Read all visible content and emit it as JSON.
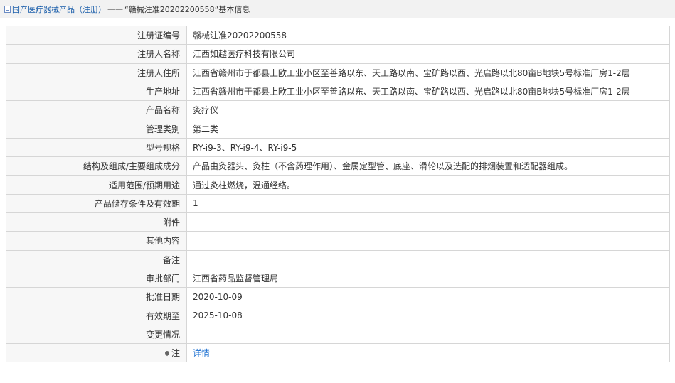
{
  "breadcrumb": {
    "root": "国产医疗器械产品（注册）",
    "separator": "——",
    "current": "“赣械注准20202200558”基本信息"
  },
  "rows": [
    {
      "label": "注册证编号",
      "value": "赣械注准20202200558"
    },
    {
      "label": "注册人名称",
      "value": "江西如越医疗科技有限公司"
    },
    {
      "label": "注册人住所",
      "value": "江西省赣州市于都县上欧工业小区至善路以东、天工路以南、宝矿路以西、光启路以北80亩B地块5号标准厂房1-2层"
    },
    {
      "label": "生产地址",
      "value": "江西省赣州市于都县上欧工业小区至善路以东、天工路以南、宝矿路以西、光启路以北80亩B地块5号标准厂房1-2层"
    },
    {
      "label": "产品名称",
      "value": "灸疗仪"
    },
    {
      "label": "管理类别",
      "value": "第二类"
    },
    {
      "label": "型号规格",
      "value": "RY-i9-3、RY-i9-4、RY-i9-5"
    },
    {
      "label": "结构及组成/主要组成成分",
      "value": "产品由灸器头、灸柱（不含药理作用）、金属定型管、底座、滑轮以及选配的排烟装置和适配器组成。"
    },
    {
      "label": "适用范围/预期用途",
      "value": "通过灸柱燃烧，温通经络。"
    },
    {
      "label": "产品储存条件及有效期",
      "value": "1"
    },
    {
      "label": "附件",
      "value": ""
    },
    {
      "label": "其他内容",
      "value": ""
    },
    {
      "label": "备注",
      "value": ""
    },
    {
      "label": "审批部门",
      "value": "江西省药品监督管理局"
    },
    {
      "label": "批准日期",
      "value": "2020-10-09"
    },
    {
      "label": "有效期至",
      "value": "2025-10-08"
    },
    {
      "label": "变更情况",
      "value": ""
    }
  ],
  "note_row": {
    "label": "注",
    "value": "详情",
    "icon": "pin-icon"
  }
}
